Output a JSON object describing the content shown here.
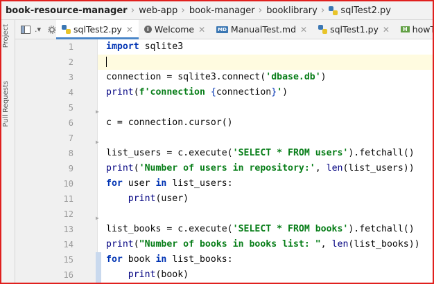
{
  "breadcrumb": {
    "items": [
      "book-resource-manager",
      "web-app",
      "book-manager",
      "booklibrary",
      "sqlTest2.py"
    ],
    "separator": "›"
  },
  "left_strip": {
    "project_label": "Project",
    "pull_requests_label": "Pull Requests"
  },
  "tabs": [
    {
      "label": "sqlTest2.py",
      "icon": "python-file-icon",
      "active": true
    },
    {
      "label": "Welcome",
      "icon": "info-icon",
      "active": false
    },
    {
      "label": "ManualTest.md",
      "icon": "markdown-file-icon",
      "active": false
    },
    {
      "label": "sqlTest1.py",
      "icon": "python-file-icon",
      "active": false
    },
    {
      "label": "howTo.html",
      "icon": "html-file-icon",
      "active": false
    }
  ],
  "editor": {
    "lines": [
      {
        "n": "1",
        "text": "import sqlite3"
      },
      {
        "n": "2",
        "text": ""
      },
      {
        "n": "3",
        "text": "connection = sqlite3.connect('dbase.db')"
      },
      {
        "n": "4",
        "text": "print(f'connection {connection}')"
      },
      {
        "n": "5",
        "text": ""
      },
      {
        "n": "6",
        "text": "c = connection.cursor()"
      },
      {
        "n": "7",
        "text": ""
      },
      {
        "n": "8",
        "text": "list_users = c.execute('SELECT * FROM users').fetchall()"
      },
      {
        "n": "9",
        "text": "print('Number of users in repository:', len(list_users))"
      },
      {
        "n": "10",
        "text": "for user in list_users:"
      },
      {
        "n": "11",
        "text": "    print(user)"
      },
      {
        "n": "12",
        "text": ""
      },
      {
        "n": "13",
        "text": "list_books = c.execute('SELECT * FROM books').fetchall()"
      },
      {
        "n": "14",
        "text": "print(\"Number of books in books list: \", len(list_books))"
      },
      {
        "n": "15",
        "text": "for book in list_books:"
      },
      {
        "n": "16",
        "text": "    print(book)"
      }
    ]
  },
  "colors": {
    "frame_border": "#e0201e",
    "active_tab_underline": "#4a86c8",
    "keyword": "#0033b3",
    "string": "#067d17"
  }
}
